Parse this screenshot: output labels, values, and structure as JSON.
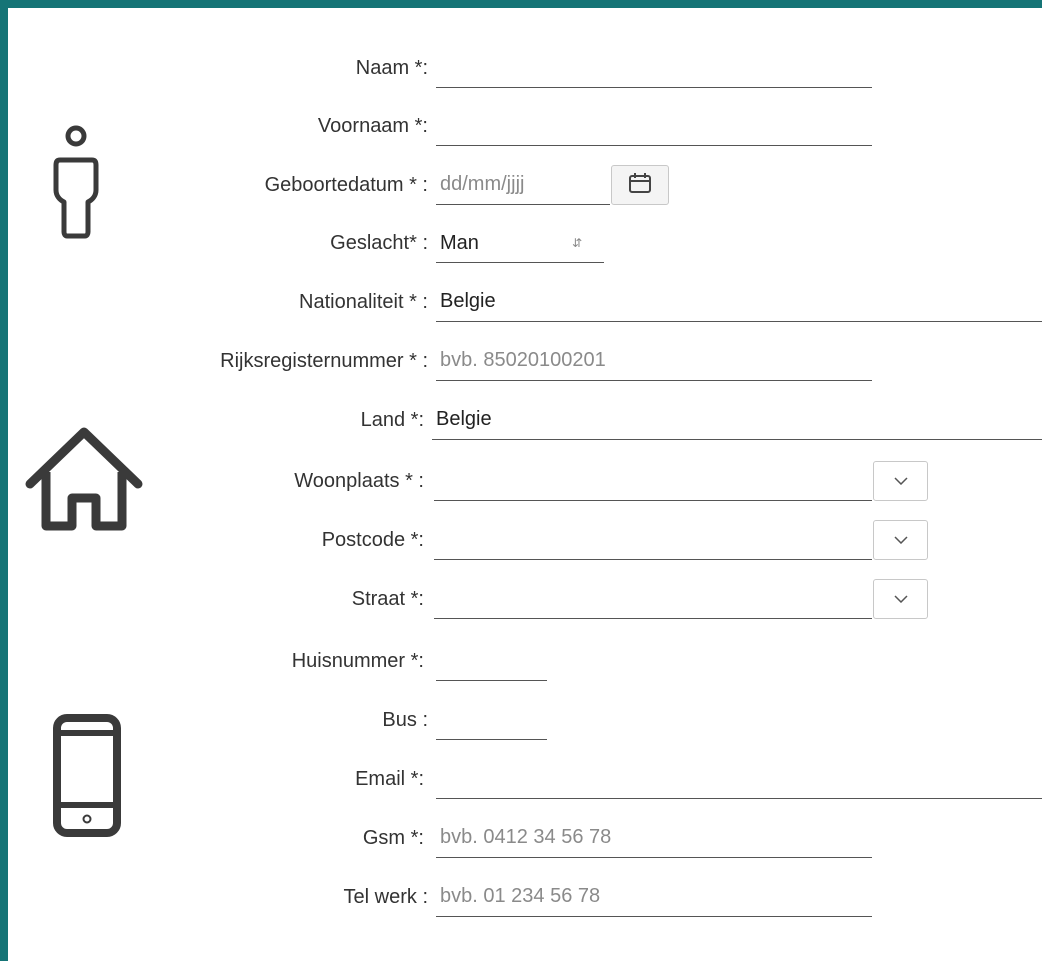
{
  "icons": {
    "person": "person-icon",
    "home": "home-icon",
    "phone": "mobile-phone-icon"
  },
  "form": {
    "naam": {
      "label": "Naam *:",
      "value": "",
      "placeholder": ""
    },
    "voornaam": {
      "label": "Voornaam *:",
      "value": "",
      "placeholder": ""
    },
    "geboortedatum": {
      "label": "Geboortedatum * :",
      "placeholder": "dd/mm/jjjj"
    },
    "geslacht": {
      "label": "Geslacht* :",
      "value": "Man"
    },
    "nationaliteit": {
      "label": "Nationaliteit * :",
      "value": "Belgie"
    },
    "rijksregisternummer": {
      "label": "Rijksregisternummer * :",
      "placeholder": "bvb. 85020100201"
    },
    "land": {
      "label": "Land *:",
      "value": "Belgie"
    },
    "woonplaats": {
      "label": "Woonplaats * :",
      "value": ""
    },
    "postcode": {
      "label": "Postcode *:",
      "value": ""
    },
    "straat": {
      "label": "Straat *:",
      "value": ""
    },
    "huisnummer": {
      "label": "Huisnummer *:",
      "value": ""
    },
    "bus": {
      "label": "Bus :",
      "value": ""
    },
    "email": {
      "label": "Email *:",
      "value": ""
    },
    "gsm": {
      "label": "Gsm *:",
      "placeholder": "bvb. 0412 34 56 78"
    },
    "telwerk": {
      "label": "Tel werk :",
      "placeholder": "bvb. 01 234 56 78"
    }
  },
  "colors": {
    "frame": "#157476",
    "text": "#333333",
    "placeholder": "#8a8a8a",
    "underline": "#555555",
    "icon": "#3a3a3a"
  }
}
